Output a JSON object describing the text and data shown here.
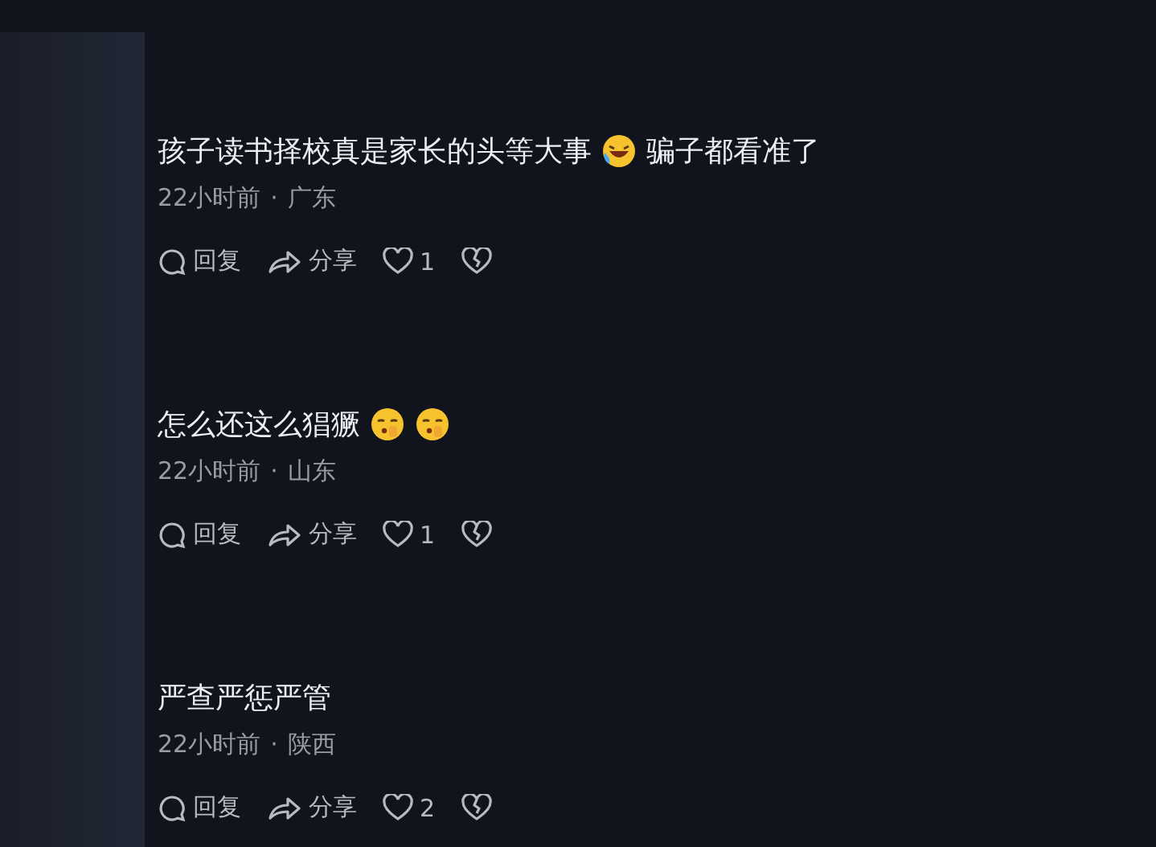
{
  "comments": [
    {
      "content": [
        {
          "kind": "text",
          "text": "孩子读书择校真是家长的头等大事"
        },
        {
          "kind": "laughing-emoji"
        },
        {
          "kind": "text",
          "text": "骗子都看准了"
        }
      ],
      "time": "22小时前",
      "separator": "·",
      "location": "广东",
      "reply": "回复",
      "share": "分享",
      "likes": "1",
      "liked": false,
      "disliked": false
    },
    {
      "content": [
        {
          "kind": "text",
          "text": "怎么还这么猖獗"
        },
        {
          "kind": "shushing-emoji"
        },
        {
          "kind": "shushing-emoji"
        }
      ],
      "time": "22小时前",
      "separator": "·",
      "location": "山东",
      "reply": "回复",
      "share": "分享",
      "likes": "1",
      "liked": false,
      "disliked": false
    },
    {
      "content": [
        {
          "kind": "text",
          "text": "严查严惩严管"
        }
      ],
      "time": "22小时前",
      "separator": "·",
      "location": "陕西",
      "reply": "回复",
      "share": "分享",
      "likes": "2",
      "liked": false,
      "disliked": false
    }
  ]
}
